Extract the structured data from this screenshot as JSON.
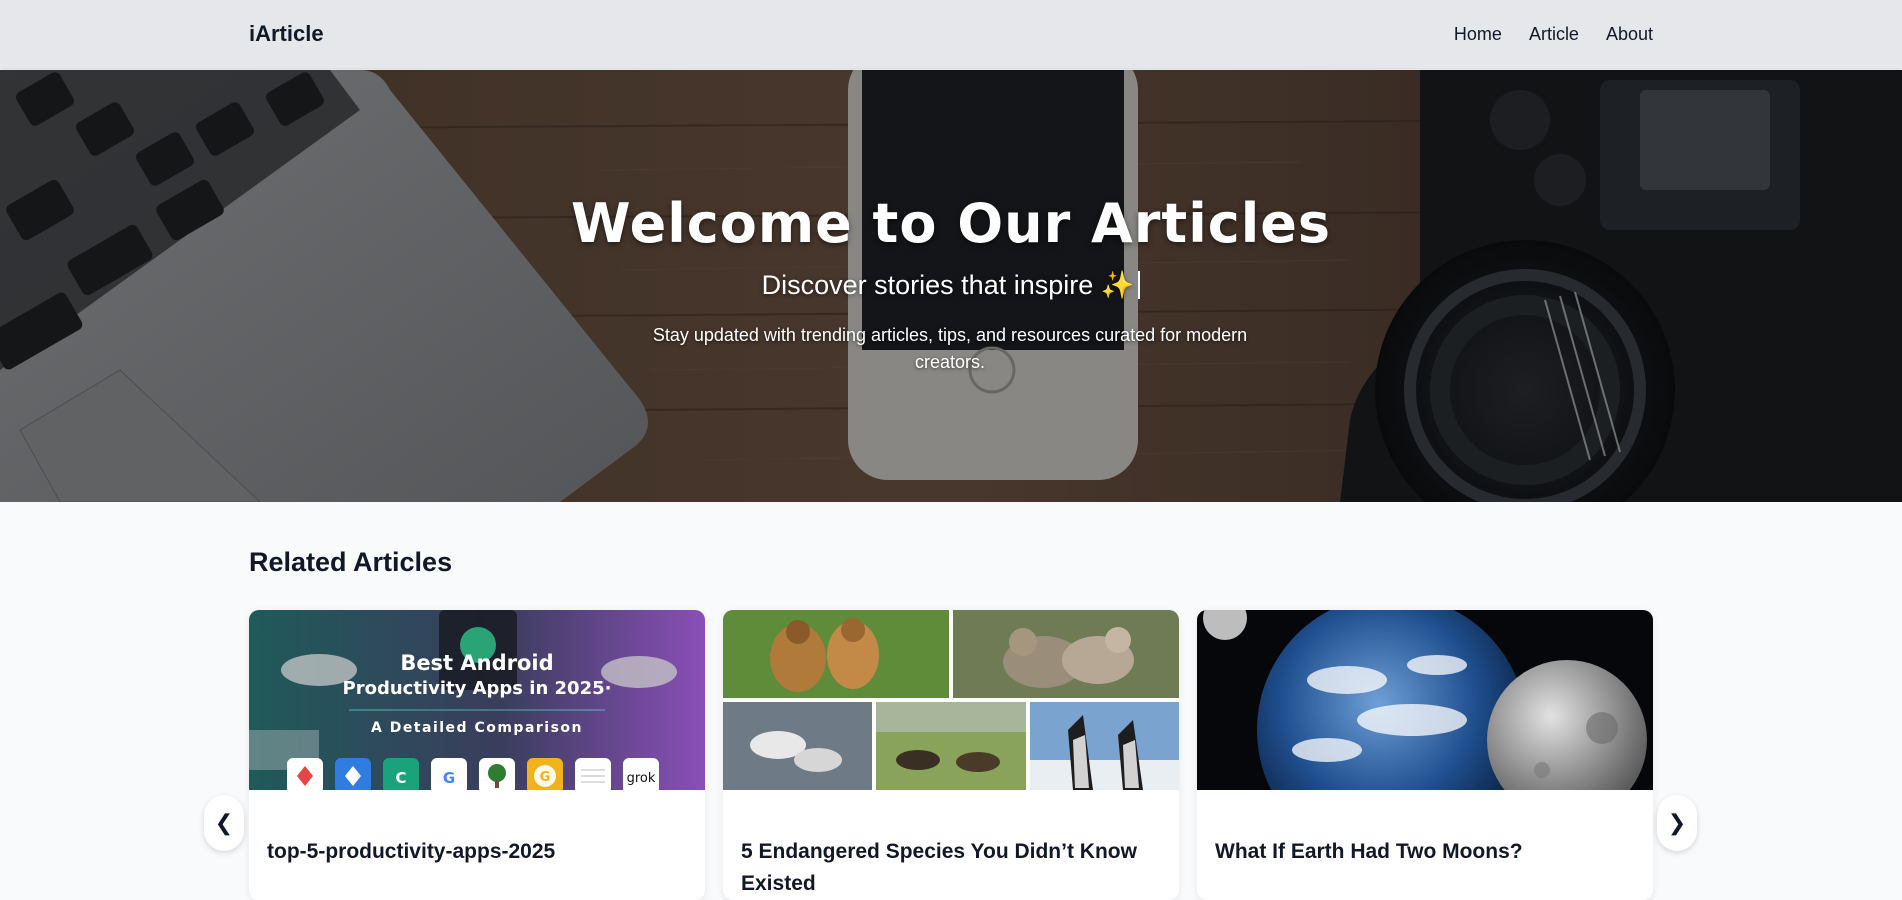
{
  "nav": {
    "brand": "iArticle",
    "links": [
      "Home",
      "Article",
      "About"
    ]
  },
  "hero": {
    "title": "Welcome to Our Articles",
    "subtitle": "Discover stories that inspire ✨",
    "description": "Stay updated with trending articles, tips, and resources curated for modern creators."
  },
  "related": {
    "heading": "Related Articles",
    "cards": [
      {
        "title": "top-5-productivity-apps-2025",
        "image_text": {
          "line1": "Best Android",
          "line2": "Productivity Apps in 2025·",
          "line3": "A Detailed Comparison",
          "app_labels": [
            "",
            "",
            "C",
            "G",
            "",
            "G",
            "",
            "grok"
          ]
        }
      },
      {
        "title": "5 Endangered Species You Didn’t Know Existed"
      },
      {
        "title": "What If Earth Had Two Moons?"
      }
    ],
    "prev_label": "❮",
    "next_label": "❯"
  },
  "colors": {
    "navbar_bg": "#e5e7eb",
    "page_bg": "#f8fafc",
    "text_dark": "#111827"
  }
}
